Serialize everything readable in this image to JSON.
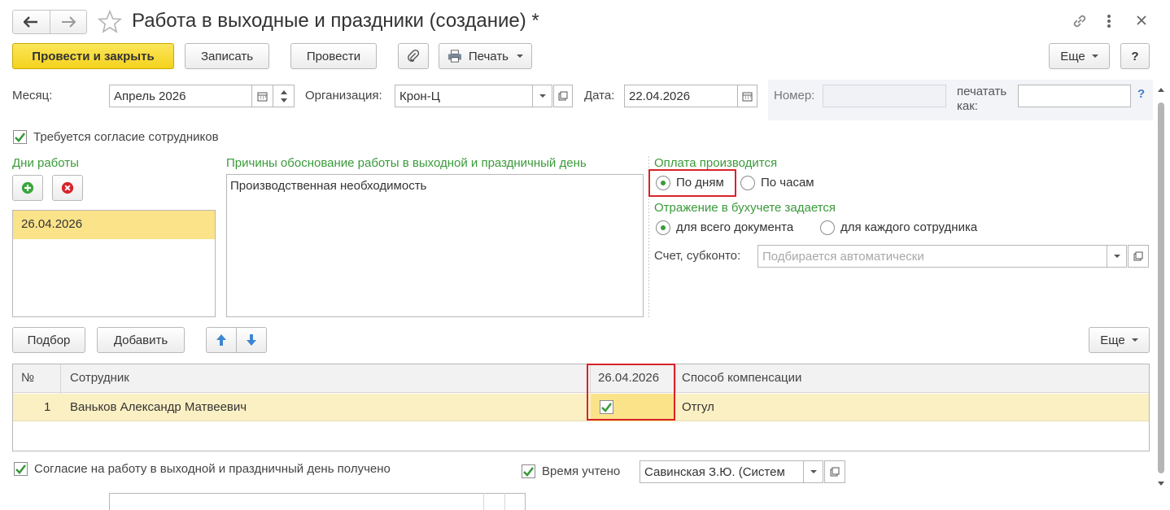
{
  "window": {
    "title": "Работа в выходные и праздники (создание) *"
  },
  "toolbar": {
    "post_close": "Провести и закрыть",
    "save": "Записать",
    "post": "Провести",
    "print": "Печать",
    "more": "Еще",
    "help": "?"
  },
  "header_fields": {
    "month_label": "Месяц:",
    "month_value": "Апрель 2026",
    "org_label": "Организация:",
    "org_value": "Крон-Ц",
    "date_label": "Дата:",
    "date_value": "22.04.2026",
    "number_label": "Номер:",
    "number_value": "",
    "print_as_label_1": "печатать",
    "print_as_label_2": "как:",
    "print_as_value": "",
    "help_q": "?"
  },
  "consent_required": {
    "label": "Требуется согласие сотрудников",
    "checked": true
  },
  "work_days": {
    "title": "Дни работы",
    "items": [
      "26.04.2026"
    ]
  },
  "reasons": {
    "title": "Причины обоснование работы в выходной и праздничный день",
    "text": "Производственная необходимость"
  },
  "payment": {
    "title": "Оплата производится",
    "by_days": "По дням",
    "by_hours": "По часам",
    "selected": "by_days"
  },
  "accounting": {
    "title": "Отражение в бухучете задается",
    "whole_doc": "для всего документа",
    "each_employee": "для каждого сотрудника",
    "selected": "whole_doc",
    "account_label": "Счет, субконто:",
    "account_placeholder": "Подбирается автоматически"
  },
  "table_toolbar": {
    "select": "Подбор",
    "add": "Добавить",
    "more": "Еще"
  },
  "table": {
    "columns": [
      "№",
      "Сотрудник",
      "26.04.2026",
      "Способ компенсации"
    ],
    "rows": [
      {
        "num": "1",
        "employee": "Ваньков Александр Матвеевич",
        "day_checked": true,
        "compensation": "Отгул"
      }
    ]
  },
  "footer": {
    "consent_received": "Согласие на работу в выходной и праздничный день получено",
    "consent_checked": true,
    "time_counted": "Время учтено",
    "time_checked": true,
    "responsible": "Савинская З.Ю. (Систем"
  },
  "colors": {
    "accent_green": "#3a9a3a",
    "highlight_yellow": "#fbe38a",
    "primary_yellow": "#f4d21d",
    "red_frame": "#d8232a"
  }
}
